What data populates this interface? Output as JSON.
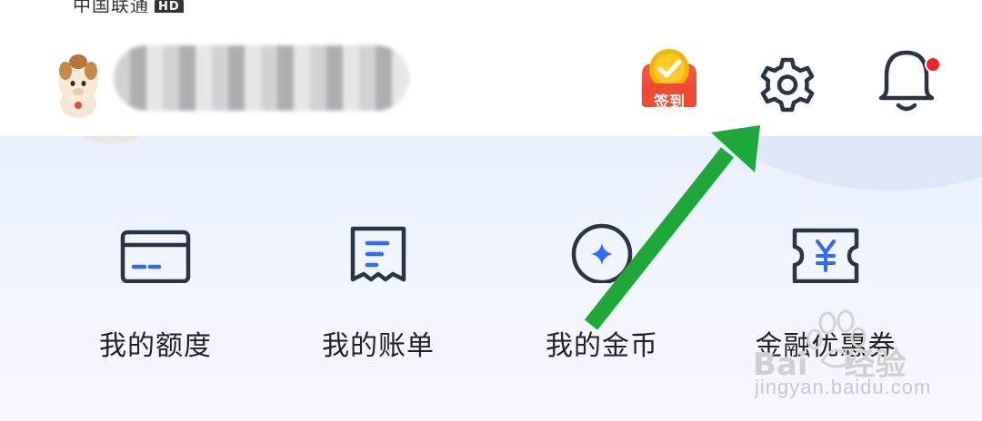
{
  "status_bar": {
    "carrier": "中国联通",
    "network_badge": "HD"
  },
  "header": {
    "checkin_label": "签到",
    "icons": {
      "checkin": "checkin-icon",
      "settings": "gear-icon",
      "notifications": "bell-icon"
    },
    "notification_dot_color": "#f5222d"
  },
  "features": [
    {
      "label": "我的额度",
      "icon": "card-icon"
    },
    {
      "label": "我的账单",
      "icon": "bill-icon"
    },
    {
      "label": "我的金币",
      "icon": "coin-icon"
    },
    {
      "label": "金融优惠券",
      "icon": "coupon-icon"
    }
  ],
  "watermark": {
    "brand": "Bai",
    "brand_suffix": "经验",
    "url": "jingyan.baidu.com"
  },
  "colors": {
    "icon_stroke": "#2b3445",
    "accent_blue": "#2f6cf6",
    "arrow_green": "#1fa83a",
    "checkin_red": "#f0533d",
    "checkin_yellow": "#f7b500"
  }
}
